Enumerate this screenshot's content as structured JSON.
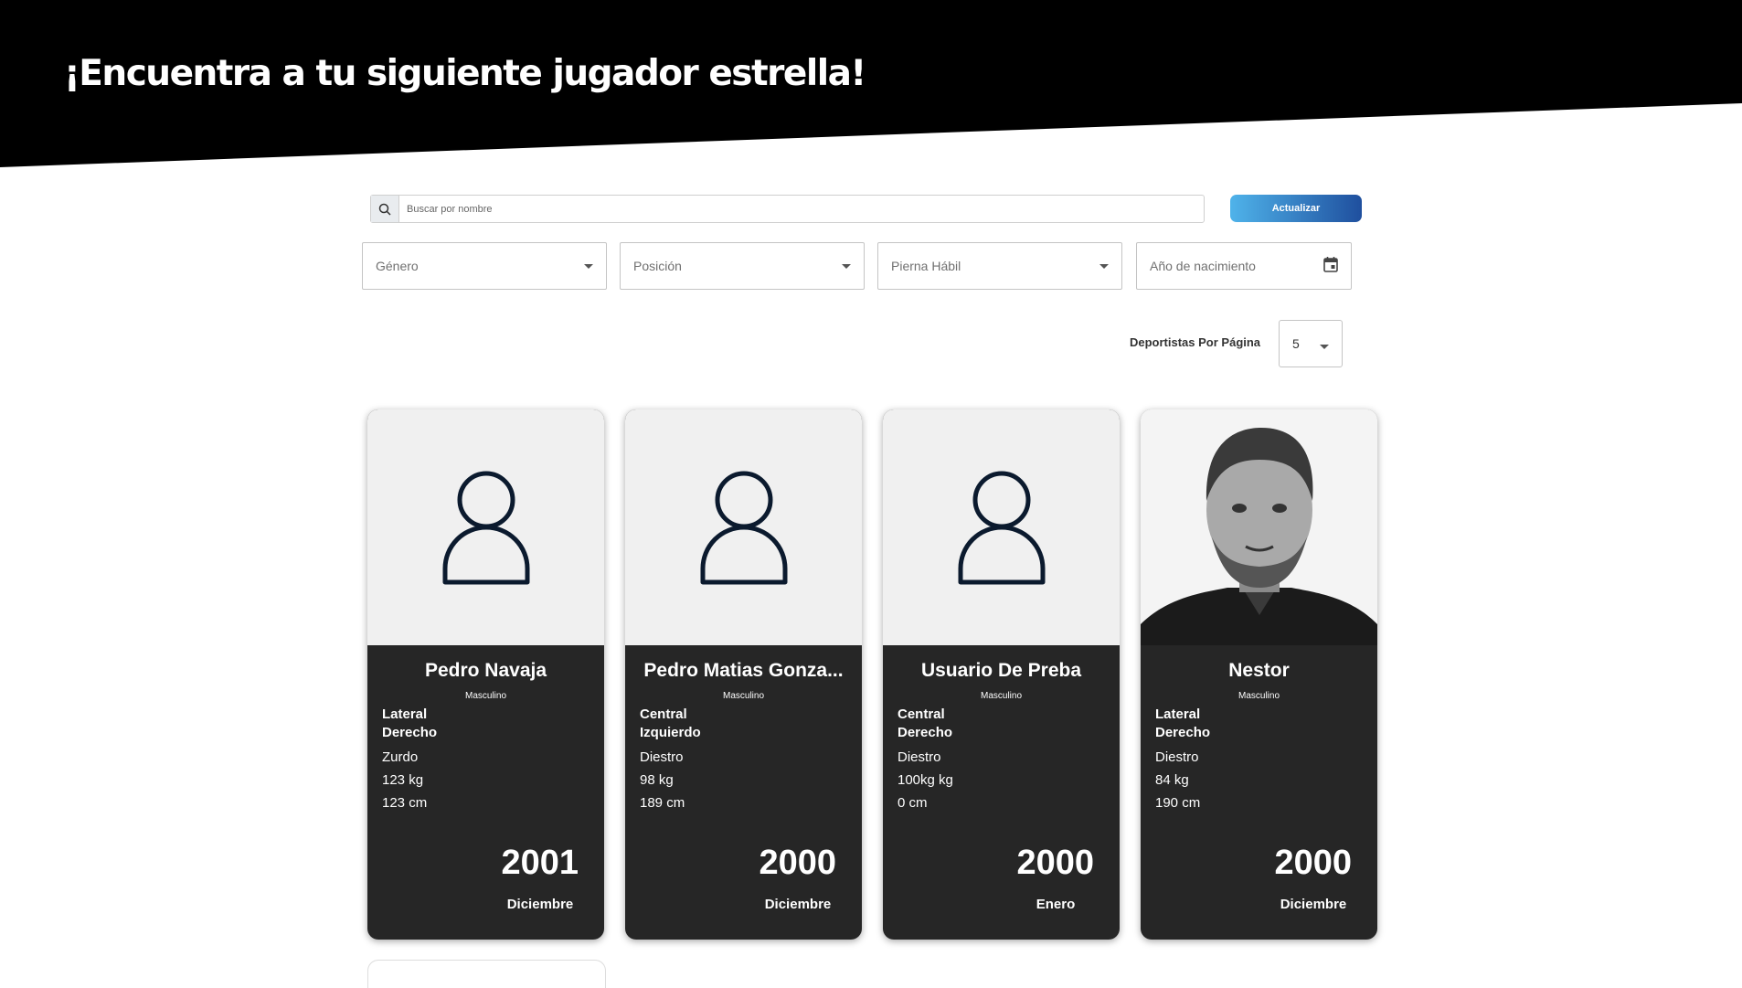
{
  "header": {
    "title": "¡Encuentra a tu siguiente jugador estrella!"
  },
  "search": {
    "placeholder": "Buscar por nombre",
    "button_label": "Actualizar"
  },
  "filters": {
    "gender": "Género",
    "position": "Posición",
    "foot": "Pierna Hábil",
    "birth_year": "Año de nacimiento"
  },
  "pagination": {
    "label": "Deportistas Por Página",
    "value": "5"
  },
  "players": [
    {
      "name": "Pedro Navaja",
      "gender": "Masculino",
      "position": "Lateral\nDerecho",
      "foot": "Zurdo",
      "weight": "123 kg",
      "height": "123 cm",
      "year": "2001",
      "month": "Diciembre",
      "photo": "person-placeholder-icon"
    },
    {
      "name": "Pedro Matias Gonza...",
      "gender": "Masculino",
      "position": "Central\nIzquierdo",
      "foot": "Diestro",
      "weight": "98 kg",
      "height": "189 cm",
      "year": "2000",
      "month": "Diciembre",
      "photo": "person-placeholder-icon"
    },
    {
      "name": "Usuario De Preba",
      "gender": "Masculino",
      "position": "Central\nDerecho",
      "foot": "Diestro",
      "weight": "100kg kg",
      "height": "0 cm",
      "year": "2000",
      "month": "Enero",
      "photo": "person-placeholder-icon"
    },
    {
      "name": "Nestor",
      "gender": "Masculino",
      "position": "Lateral\nDerecho",
      "foot": "Diestro",
      "weight": "84 kg",
      "height": "190 cm",
      "year": "2000",
      "month": "Diciembre",
      "photo": "portrait-photo"
    }
  ]
}
